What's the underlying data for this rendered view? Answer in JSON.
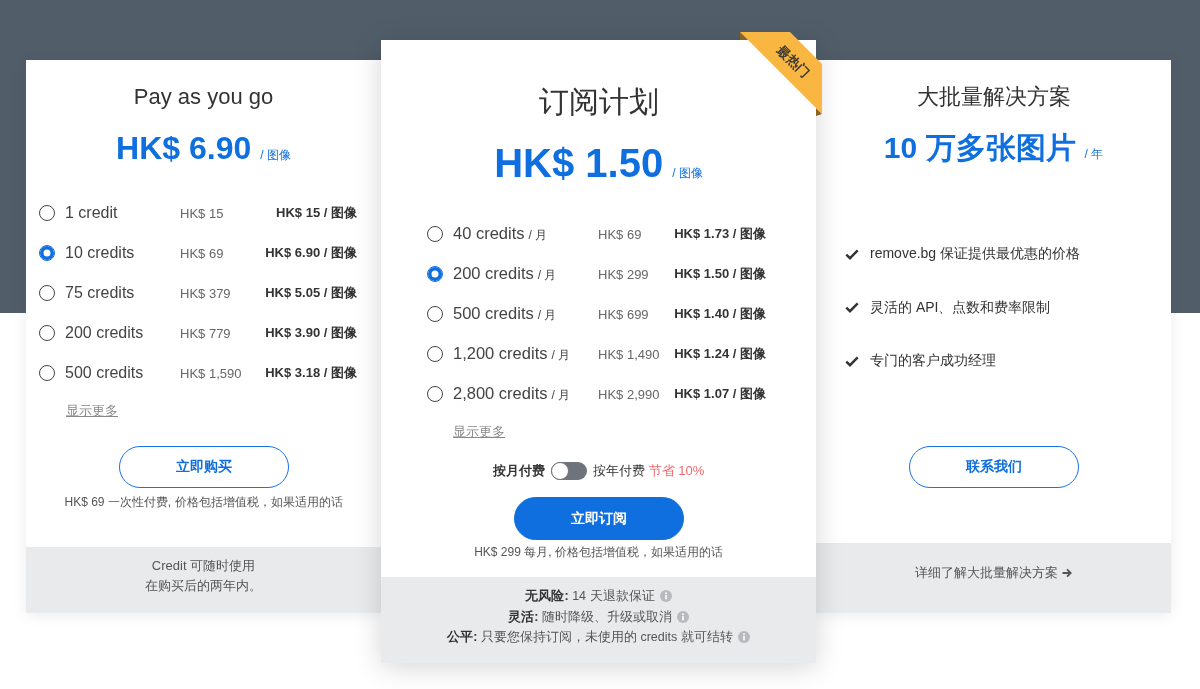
{
  "plans": [
    {
      "kind": "credit_packs",
      "title": "Pay as you go",
      "price": "HK$ 6.90",
      "price_unit": "/ 图像",
      "options": [
        {
          "credits": "1 credit",
          "total": "HK$ 15",
          "per_image": "HK$ 15 / 图像",
          "selected": false
        },
        {
          "credits": "10 credits",
          "total": "HK$ 69",
          "per_image": "HK$ 6.90 / 图像",
          "selected": true
        },
        {
          "credits": "75 credits",
          "total": "HK$ 379",
          "per_image": "HK$ 5.05 / 图像",
          "selected": false
        },
        {
          "credits": "200 credits",
          "total": "HK$ 779",
          "per_image": "HK$ 3.90 / 图像",
          "selected": false
        },
        {
          "credits": "500 credits",
          "total": "HK$ 1,590",
          "per_image": "HK$ 3.18 / 图像",
          "selected": false
        }
      ],
      "show_more": "显示更多",
      "button": "立即购买",
      "note": "HK$ 69 一次性付费, 价格包括增值税，如果适用的话",
      "footer_note": [
        "Credit 可随时使用",
        "在购买后的两年内。"
      ]
    },
    {
      "kind": "subscription",
      "badge": "最热门",
      "title": "订阅计划",
      "price": "HK$ 1.50",
      "price_unit": "/ 图像",
      "options": [
        {
          "credits": "40 credits",
          "period": "/ 月",
          "total": "HK$ 69",
          "per_image": "HK$ 1.73 / 图像",
          "selected": false
        },
        {
          "credits": "200 credits",
          "period": "/ 月",
          "total": "HK$ 299",
          "per_image": "HK$ 1.50 / 图像",
          "selected": true
        },
        {
          "credits": "500 credits",
          "period": "/ 月",
          "total": "HK$ 699",
          "per_image": "HK$ 1.40 / 图像",
          "selected": false
        },
        {
          "credits": "1,200 credits",
          "period": "/ 月",
          "total": "HK$ 1,490",
          "per_image": "HK$ 1.24 / 图像",
          "selected": false
        },
        {
          "credits": "2,800 credits",
          "period": "/ 月",
          "total": "HK$ 2,990",
          "per_image": "HK$ 1.07 / 图像",
          "selected": false
        }
      ],
      "show_more": "显示更多",
      "billing_toggle": {
        "monthly_label": "按月付费",
        "yearly_label": "按年付费",
        "savings": "节省 10%",
        "on": false
      },
      "button": "立即订阅",
      "note": "HK$ 299 每月, 价格包括增值税，如果适用的话",
      "guarantees": [
        "**无风险:** 14 天退款保证",
        "**灵活:** 随时降级、升级或取消",
        "**公平:** 只要您保持订阅，未使用的 credits 就可结转"
      ]
    },
    {
      "kind": "bulk",
      "title": "大批量解决方案",
      "price": "10 万多张图片",
      "price_unit": "/ 年",
      "features": [
        "remove.bg 保证提供最优惠的价格",
        "灵活的 API、点数和费率限制",
        "专门的客户成功经理"
      ],
      "button": "联系我们",
      "footer_link": "详细了解大批量解决方案"
    }
  ]
}
